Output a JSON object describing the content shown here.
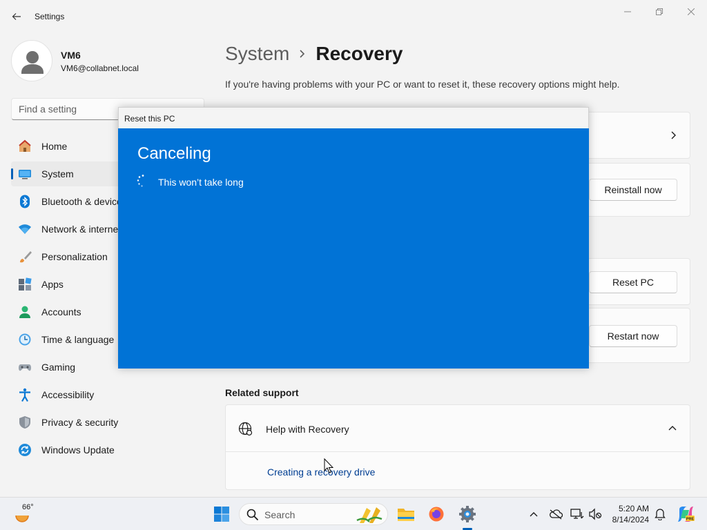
{
  "window": {
    "title": "Settings",
    "controls": [
      "minimize",
      "maximize",
      "close"
    ]
  },
  "user": {
    "name": "VM6",
    "email": "VM6@collabnet.local"
  },
  "search": {
    "placeholder": "Find a setting"
  },
  "sidebar": {
    "items": [
      {
        "label": "Home",
        "icon": "home-icon"
      },
      {
        "label": "System",
        "icon": "system-icon",
        "selected": true
      },
      {
        "label": "Bluetooth & devices",
        "icon": "bluetooth-icon"
      },
      {
        "label": "Network & internet",
        "icon": "network-icon"
      },
      {
        "label": "Personalization",
        "icon": "brush-icon"
      },
      {
        "label": "Apps",
        "icon": "apps-icon"
      },
      {
        "label": "Accounts",
        "icon": "accounts-icon"
      },
      {
        "label": "Time & language",
        "icon": "clock-icon"
      },
      {
        "label": "Gaming",
        "icon": "gamepad-icon"
      },
      {
        "label": "Accessibility",
        "icon": "accessibility-icon"
      },
      {
        "label": "Privacy & security",
        "icon": "shield-icon"
      },
      {
        "label": "Windows Update",
        "icon": "update-icon"
      }
    ]
  },
  "main": {
    "breadcrumb_parent": "System",
    "breadcrumb_current": "Recovery",
    "description": "If you're having problems with your PC or want to reset it, these recovery options might help.",
    "buttons": {
      "reinstall": "Reinstall now",
      "reset": "Reset PC",
      "restart": "Restart now"
    },
    "related_support_title": "Related support",
    "help": {
      "title": "Help with Recovery",
      "link": "Creating a recovery drive"
    }
  },
  "dialog": {
    "title": "Reset this PC",
    "heading": "Canceling",
    "message": "This won’t take long",
    "background": "#0173d6"
  },
  "taskbar": {
    "weather_temp": "66°",
    "search_label": "Search",
    "time": "5:20 AM",
    "date": "8/14/2024"
  },
  "colors": {
    "accent": "#005fb8",
    "link": "#003e92"
  }
}
